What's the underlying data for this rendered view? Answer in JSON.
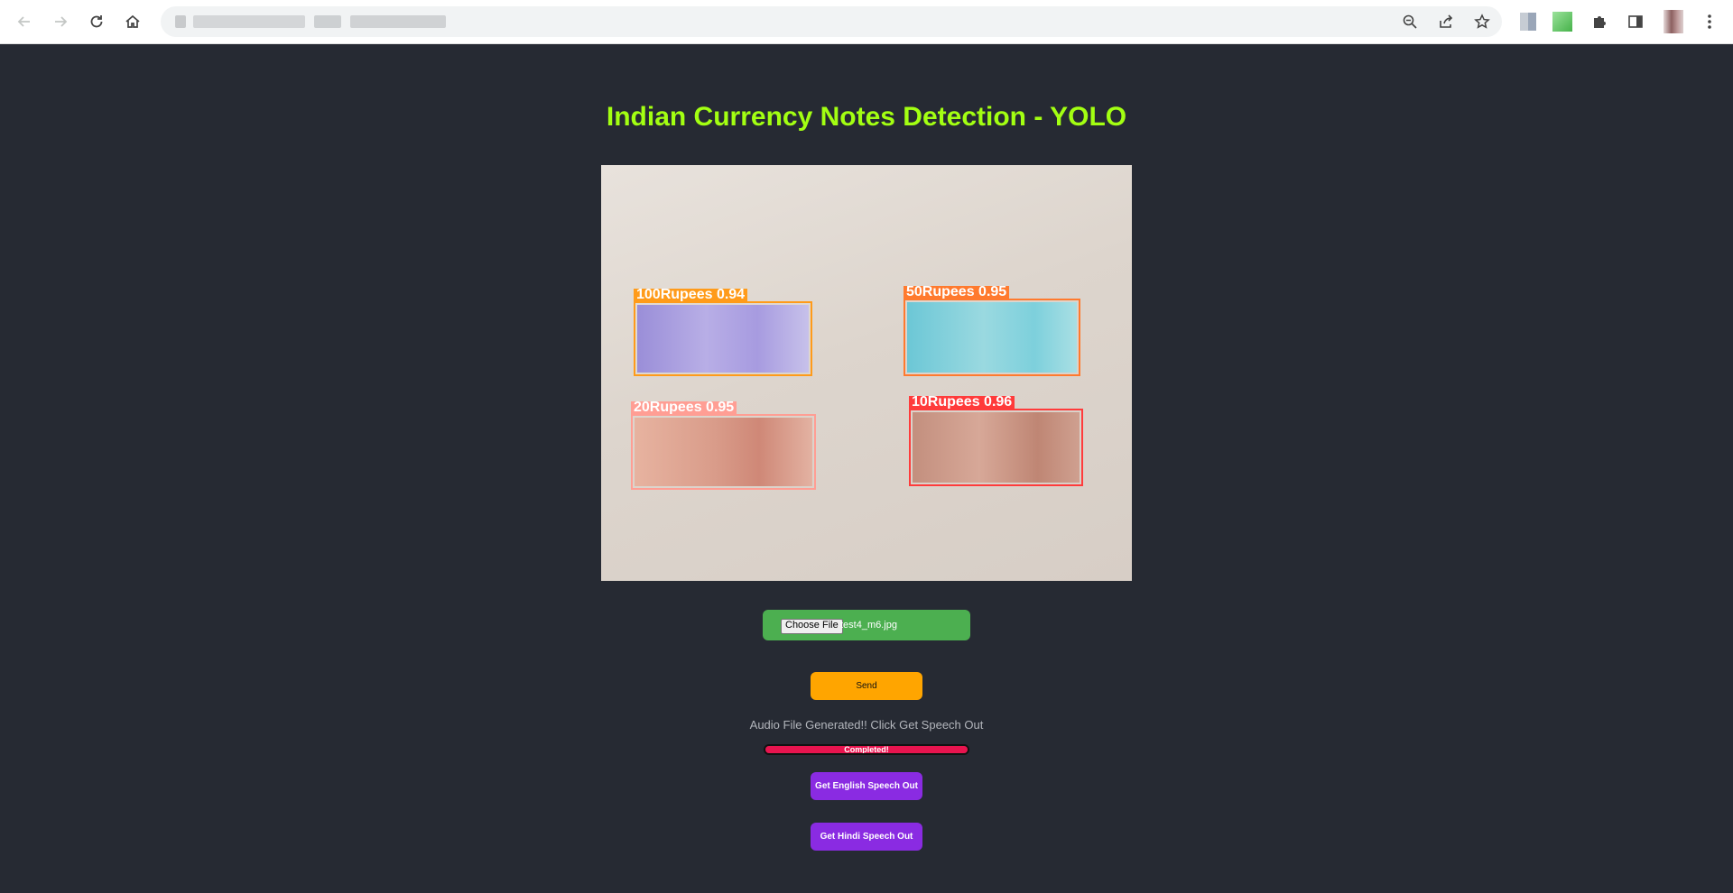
{
  "browser": {
    "back_icon": "arrow-left-icon",
    "forward_icon": "arrow-right-icon",
    "reload_icon": "reload-icon",
    "home_icon": "home-icon",
    "omnibox_icons": [
      "zoom-out-icon",
      "share-icon",
      "star-icon"
    ],
    "toolbar_icons": [
      "extension-a-icon",
      "extension-b-icon",
      "puzzle-icon",
      "side-panel-icon",
      "profile-avatar",
      "kebab-menu-icon"
    ]
  },
  "page": {
    "title": "Indian Currency Notes Detection - YOLO",
    "title_color": "#a3ff12",
    "background": "#262a33"
  },
  "detections": [
    {
      "label": "100Rupees 0.94",
      "class": "100Rupees",
      "confidence": 0.94,
      "box_color": "#ff9b1a",
      "note_color": "#a79be0"
    },
    {
      "label": "50Rupees 0.95",
      "class": "50Rupees",
      "confidence": 0.95,
      "box_color": "#ff7a2e",
      "note_color": "#7dd0dc"
    },
    {
      "label": "20Rupees 0.95",
      "class": "20Rupees",
      "confidence": 0.95,
      "box_color": "#ff9e94",
      "note_color": "#d99c8a"
    },
    {
      "label": "10Rupees 0.96",
      "class": "10Rupees",
      "confidence": 0.96,
      "box_color": "#ff3b3b",
      "note_color": "#bf8674"
    }
  ],
  "file_input": {
    "button_label": "Choose File",
    "file_name": "test4_m6.jpg",
    "background": "#4caf50"
  },
  "send_button": {
    "label": "Send",
    "color": "#ffa500"
  },
  "status_text": "Audio File Generated!! Click Get Speech Out",
  "progress": {
    "label": "Completed!",
    "fraction": 1.0,
    "color": "#e8144f"
  },
  "speech_buttons": {
    "english": "Get English Speech Out",
    "hindi": "Get Hindi Speech Out",
    "color": "#8a2be2"
  }
}
